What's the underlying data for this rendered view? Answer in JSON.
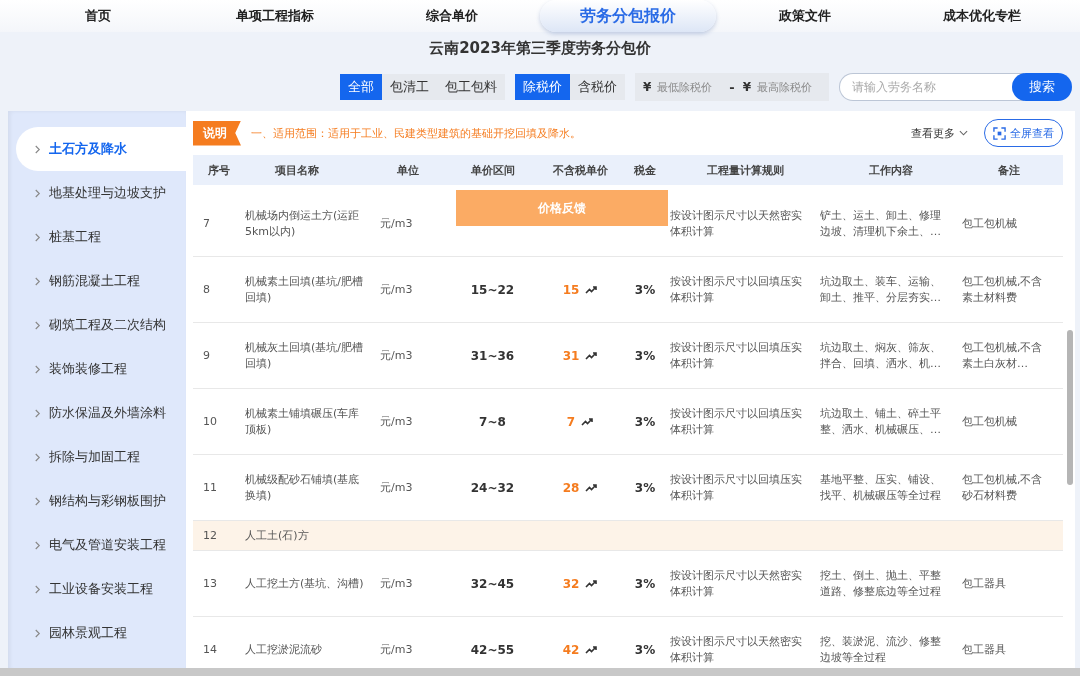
{
  "nav": [
    {
      "label": "首页",
      "selected": false
    },
    {
      "label": "单项工程指标",
      "selected": false
    },
    {
      "label": "综合单价",
      "selected": false
    },
    {
      "label": "劳务分包报价",
      "selected": true
    },
    {
      "label": "政策文件",
      "selected": false
    },
    {
      "label": "成本优化专栏",
      "selected": false
    }
  ],
  "page_title": "云南2023年第三季度劳务分包价",
  "scope_filter": [
    {
      "label": "全部",
      "selected": true
    },
    {
      "label": "包清工",
      "selected": false
    },
    {
      "label": "包工包料",
      "selected": false
    }
  ],
  "tax_filter": [
    {
      "label": "除税价",
      "selected": true
    },
    {
      "label": "含税价",
      "selected": false
    }
  ],
  "price_range": {
    "currency": "¥",
    "min_placeholder": "最低除税价",
    "separator": "-",
    "max_placeholder": "最高除税价"
  },
  "search": {
    "placeholder": "请输入劳务名称",
    "button": "搜索"
  },
  "sidebar": [
    {
      "label": "土石方及降水",
      "selected": true
    },
    {
      "label": "地基处理与边坡支护",
      "selected": false
    },
    {
      "label": "桩基工程",
      "selected": false
    },
    {
      "label": "钢筋混凝土工程",
      "selected": false
    },
    {
      "label": "砌筑工程及二次结构",
      "selected": false
    },
    {
      "label": "装饰装修工程",
      "selected": false
    },
    {
      "label": "防水保温及外墙涂料",
      "selected": false
    },
    {
      "label": "拆除与加固工程",
      "selected": false
    },
    {
      "label": "钢结构与彩钢板围护",
      "selected": false
    },
    {
      "label": "电气及管道安装工程",
      "selected": false
    },
    {
      "label": "工业设备安装工程",
      "selected": false
    },
    {
      "label": "园林景观工程",
      "selected": false
    }
  ],
  "note": {
    "tag": "说明",
    "text": "一、适用范围：适用于工业、民建类型建筑的基础开挖回填及降水。",
    "more": "查看更多",
    "fullscreen": "全屏查看"
  },
  "table": {
    "columns": [
      "序号",
      "项目名称",
      "单位",
      "单价区间",
      "不含税单价",
      "税金",
      "工程量计算规则",
      "工作内容",
      "备注"
    ],
    "rows": [
      {
        "kind": "item",
        "no": "7",
        "name": "机械场内倒运土方(运距5km以内)",
        "unit": "元/m3",
        "rule": "按设计图示尺寸以天然密实体积计算",
        "work": "铲土、运土、卸土、修理边坡、清理机下余土、…",
        "remark": "包工包机械"
      },
      {
        "kind": "item",
        "no": "8",
        "name": "机械素土回填(基坑/肥槽回填)",
        "unit": "元/m3",
        "range": "15~22",
        "price": "15",
        "tax": "3%",
        "rule": "按设计图示尺寸以回填压实体积计算",
        "work": "坑边取土、装车、运输、卸土、推平、分层夯实…",
        "remark": "包工包机械,不含素土材料费"
      },
      {
        "kind": "item",
        "no": "9",
        "name": "机械灰土回填(基坑/肥槽回填)",
        "unit": "元/m3",
        "range": "31~36",
        "price": "31",
        "tax": "3%",
        "rule": "按设计图示尺寸以回填压实体积计算",
        "work": "坑边取土、焖灰、筛灰、拌合、回填、洒水、机…",
        "remark": "包工包机械,不含素土白灰材…"
      },
      {
        "kind": "item",
        "no": "10",
        "name": "机械素土铺填碾压(车库顶板)",
        "unit": "元/m3",
        "range": "7~8",
        "price": "7",
        "tax": "3%",
        "rule": "按设计图示尺寸以回填压实体积计算",
        "work": "坑边取土、铺土、碎土平整、洒水、机械碾压、…",
        "remark": "包工包机械"
      },
      {
        "kind": "item",
        "no": "11",
        "name": "机械级配砂石铺填(基底换填)",
        "unit": "元/m3",
        "range": "24~32",
        "price": "28",
        "tax": "3%",
        "rule": "按设计图示尺寸以回填压实体积计算",
        "work": "基地平整、压实、铺设、找平、机械碾压等全过程",
        "remark": "包工包机械,不含砂石材料费"
      },
      {
        "kind": "group",
        "no": "12",
        "name": "人工土(石)方"
      },
      {
        "kind": "item",
        "no": "13",
        "name": "人工挖土方(基坑、沟槽)",
        "unit": "元/m3",
        "range": "32~45",
        "price": "32",
        "tax": "3%",
        "rule": "按设计图示尺寸以天然密实体积计算",
        "work": "挖土、倒土、抛土、平整道路、修整底边等全过程",
        "remark": "包工器具"
      },
      {
        "kind": "item",
        "no": "14",
        "name": "人工挖淤泥流砂",
        "unit": "元/m3",
        "range": "42~55",
        "price": "42",
        "tax": "3%",
        "rule": "按设计图示尺寸以天然密实体积计算",
        "work": "挖、装淤泥、流沙、修整边坡等全过程",
        "remark": "包工器具"
      }
    ]
  },
  "feedback_popup": "价格反馈"
}
